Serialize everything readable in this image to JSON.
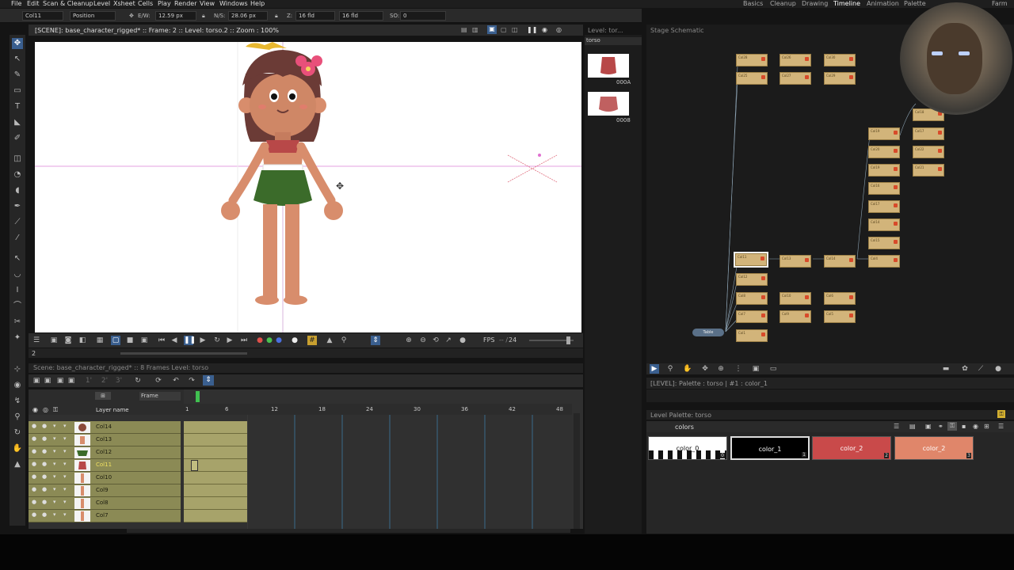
{
  "menu": [
    "File",
    "Edit",
    "Scan & Cleanup",
    "Level",
    "Xsheet",
    "Cells",
    "Play",
    "Render",
    "View",
    "Windows",
    "Help"
  ],
  "rooms": [
    "Basics",
    "Cleanup",
    "Drawing",
    "Timeline",
    "Animation",
    "Palette",
    "Farm"
  ],
  "toolopts": {
    "column": "Col11",
    "mode": "Position",
    "ew_label": "E/W:",
    "ew_value": "12.59 px",
    "ns_label": "N/S:",
    "ns_value": "28.06 px",
    "z_label": "Z:",
    "z_value": "16 fld",
    "z2_value": "16 fld",
    "so_label": "SO:",
    "so_value": "0"
  },
  "viewer": {
    "title": "[SCENE]: base_character_rigged*  ::  Frame: 2  ::  Level: torso.2  ::  Zoom : 100%",
    "fps_label": "FPS",
    "fps_value": "24",
    "frame_field": "2"
  },
  "levelstrip": {
    "header": "Level: tor...",
    "level_name": "torso",
    "frames": [
      {
        "label": "000A"
      },
      {
        "label": "0008"
      }
    ]
  },
  "schematic": {
    "title": "Stage Schematic",
    "table_label": "Table"
  },
  "palette": {
    "level_header": "[LEVEL]: Palette : torso | #1 : color_1",
    "viewer_header": "Level Palette: torso",
    "tab": "colors",
    "chips": [
      {
        "name": "color_0",
        "index": "0",
        "bg": "#ffffff",
        "fg": "#111111"
      },
      {
        "name": "color_1",
        "index": "1",
        "bg": "#000000",
        "fg": "#ffffff"
      },
      {
        "name": "color_2",
        "index": "2",
        "bg": "#c94a4a",
        "fg": "#ffffff"
      },
      {
        "name": "color_2",
        "index": "3",
        "bg": "#e0866a",
        "fg": "#ffffff"
      }
    ]
  },
  "xsheet": {
    "header": "Scene: base_character_rigged*  ::  8 Frames  Level: torso",
    "layer_name_header": "Layer name",
    "frame_label": "Frame",
    "ruler": [
      "1",
      "6",
      "12",
      "18",
      "24",
      "30",
      "36",
      "42",
      "48"
    ],
    "layers": [
      {
        "name": "Col14",
        "current": false
      },
      {
        "name": "Col13",
        "current": false
      },
      {
        "name": "Col12",
        "current": false
      },
      {
        "name": "Col11",
        "current": true
      },
      {
        "name": "Col10",
        "current": false
      },
      {
        "name": "Col9",
        "current": false
      },
      {
        "name": "Col8",
        "current": false
      },
      {
        "name": "Col7",
        "current": false
      }
    ]
  },
  "colors": {
    "accent": "#4a8fd8",
    "selected_layer": "#f0e060",
    "cell": "#a7a36a",
    "layer": "#8b8a55"
  }
}
